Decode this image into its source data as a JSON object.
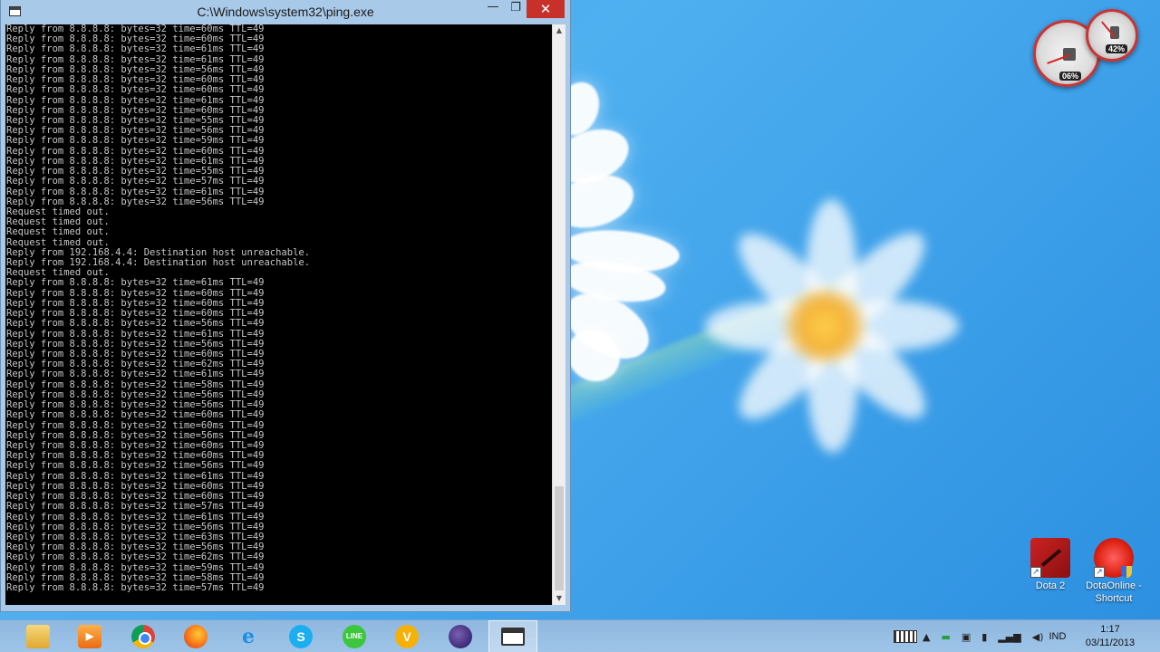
{
  "window": {
    "title": "C:\\Windows\\system32\\ping.exe",
    "min_glyph": "—",
    "max_glyph": "❐",
    "close_glyph": "✕"
  },
  "console": {
    "lines": [
      "Reply from 8.8.8.8: bytes=32 time=60ms TTL=49",
      "Reply from 8.8.8.8: bytes=32 time=60ms TTL=49",
      "Reply from 8.8.8.8: bytes=32 time=61ms TTL=49",
      "Reply from 8.8.8.8: bytes=32 time=61ms TTL=49",
      "Reply from 8.8.8.8: bytes=32 time=56ms TTL=49",
      "Reply from 8.8.8.8: bytes=32 time=60ms TTL=49",
      "Reply from 8.8.8.8: bytes=32 time=60ms TTL=49",
      "Reply from 8.8.8.8: bytes=32 time=61ms TTL=49",
      "Reply from 8.8.8.8: bytes=32 time=60ms TTL=49",
      "Reply from 8.8.8.8: bytes=32 time=55ms TTL=49",
      "Reply from 8.8.8.8: bytes=32 time=56ms TTL=49",
      "Reply from 8.8.8.8: bytes=32 time=59ms TTL=49",
      "Reply from 8.8.8.8: bytes=32 time=60ms TTL=49",
      "Reply from 8.8.8.8: bytes=32 time=61ms TTL=49",
      "Reply from 8.8.8.8: bytes=32 time=55ms TTL=49",
      "Reply from 8.8.8.8: bytes=32 time=57ms TTL=49",
      "Reply from 8.8.8.8: bytes=32 time=61ms TTL=49",
      "Reply from 8.8.8.8: bytes=32 time=56ms TTL=49",
      "Request timed out.",
      "Request timed out.",
      "Request timed out.",
      "Request timed out.",
      "Reply from 192.168.4.4: Destination host unreachable.",
      "Reply from 192.168.4.4: Destination host unreachable.",
      "Request timed out.",
      "Reply from 8.8.8.8: bytes=32 time=61ms TTL=49",
      "Reply from 8.8.8.8: bytes=32 time=60ms TTL=49",
      "Reply from 8.8.8.8: bytes=32 time=60ms TTL=49",
      "Reply from 8.8.8.8: bytes=32 time=60ms TTL=49",
      "Reply from 8.8.8.8: bytes=32 time=56ms TTL=49",
      "Reply from 8.8.8.8: bytes=32 time=61ms TTL=49",
      "Reply from 8.8.8.8: bytes=32 time=56ms TTL=49",
      "Reply from 8.8.8.8: bytes=32 time=60ms TTL=49",
      "Reply from 8.8.8.8: bytes=32 time=62ms TTL=49",
      "Reply from 8.8.8.8: bytes=32 time=61ms TTL=49",
      "Reply from 8.8.8.8: bytes=32 time=58ms TTL=49",
      "Reply from 8.8.8.8: bytes=32 time=56ms TTL=49",
      "Reply from 8.8.8.8: bytes=32 time=56ms TTL=49",
      "Reply from 8.8.8.8: bytes=32 time=60ms TTL=49",
      "Reply from 8.8.8.8: bytes=32 time=60ms TTL=49",
      "Reply from 8.8.8.8: bytes=32 time=56ms TTL=49",
      "Reply from 8.8.8.8: bytes=32 time=60ms TTL=49",
      "Reply from 8.8.8.8: bytes=32 time=60ms TTL=49",
      "Reply from 8.8.8.8: bytes=32 time=56ms TTL=49",
      "Reply from 8.8.8.8: bytes=32 time=61ms TTL=49",
      "Reply from 8.8.8.8: bytes=32 time=60ms TTL=49",
      "Reply from 8.8.8.8: bytes=32 time=60ms TTL=49",
      "Reply from 8.8.8.8: bytes=32 time=57ms TTL=49",
      "Reply from 8.8.8.8: bytes=32 time=61ms TTL=49",
      "Reply from 8.8.8.8: bytes=32 time=56ms TTL=49",
      "Reply from 8.8.8.8: bytes=32 time=63ms TTL=49",
      "Reply from 8.8.8.8: bytes=32 time=56ms TTL=49",
      "Reply from 8.8.8.8: bytes=32 time=62ms TTL=49",
      "Reply from 8.8.8.8: bytes=32 time=59ms TTL=49",
      "Reply from 8.8.8.8: bytes=32 time=58ms TTL=49",
      "Reply from 8.8.8.8: bytes=32 time=57ms TTL=49"
    ],
    "colors": {
      "background": "#000000",
      "text": "#c8c8c8"
    }
  },
  "gadgets": {
    "cpu": {
      "value": "06%"
    },
    "memory": {
      "value": "42%"
    }
  },
  "desktop_icons": [
    {
      "label": "Dota 2",
      "icon": "dota2-icon"
    },
    {
      "label": "DotaOnline - Shortcut",
      "icon": "dotaonline-icon"
    }
  ],
  "taskbar": {
    "items": [
      {
        "name": "file-explorer",
        "icon": "folder-icon",
        "glyph": ""
      },
      {
        "name": "media-player",
        "icon": "media-player-icon",
        "glyph": "▶"
      },
      {
        "name": "chrome",
        "icon": "chrome-icon",
        "glyph": ""
      },
      {
        "name": "firefox",
        "icon": "firefox-icon",
        "glyph": ""
      },
      {
        "name": "internet-explorer",
        "icon": "ie-icon",
        "glyph": "e"
      },
      {
        "name": "skype",
        "icon": "skype-icon",
        "glyph": "S"
      },
      {
        "name": "line",
        "icon": "line-icon",
        "glyph": "LINE"
      },
      {
        "name": "vlc-v",
        "icon": "v-icon",
        "glyph": "V"
      },
      {
        "name": "eclipse",
        "icon": "eclipse-icon",
        "glyph": ""
      },
      {
        "name": "ping-console",
        "icon": "console-icon",
        "glyph": "",
        "active": true
      }
    ],
    "tray": {
      "language": "IND",
      "time": "1:17",
      "date": "03/11/2013"
    }
  },
  "colors": {
    "desktop": "#3da3ea",
    "taskbar": "#9ec4e8",
    "close_button": "#c7312a",
    "window_frame": "#a9c9e8"
  }
}
